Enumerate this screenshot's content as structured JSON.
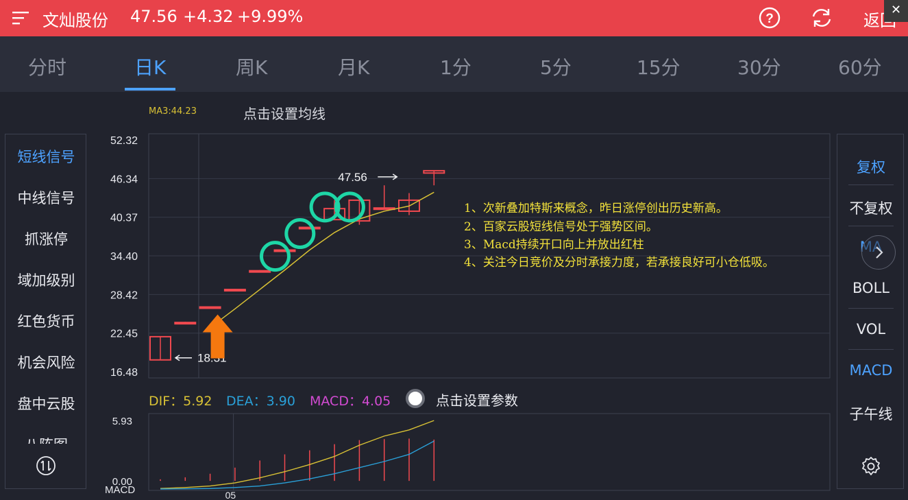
{
  "header": {
    "stock_name": "文灿股份",
    "price": "47.56",
    "change": "+4.32",
    "change_pct": "+9.99%",
    "back_label": "返回",
    "close_label": "✕"
  },
  "tabs": [
    {
      "label": "分时"
    },
    {
      "label": "日K"
    },
    {
      "label": "周K"
    },
    {
      "label": "月K"
    },
    {
      "label": "1分"
    },
    {
      "label": "5分"
    },
    {
      "label": "15分"
    },
    {
      "label": "30分"
    },
    {
      "label": "60分"
    }
  ],
  "active_tab": "日K",
  "ma_label": "MA3:44.23",
  "ma_setting": "点击设置均线",
  "left_menu": [
    {
      "label": "短线信号"
    },
    {
      "label": "中线信号"
    },
    {
      "label": "抓涨停"
    },
    {
      "label": "域加级别"
    },
    {
      "label": "红色货币"
    },
    {
      "label": "机会风险"
    },
    {
      "label": "盘中云股"
    },
    {
      "label": "八阵图"
    }
  ],
  "right_menu": [
    {
      "label": "复权"
    },
    {
      "label": "不复权"
    },
    {
      "label": "MA"
    },
    {
      "label": "BOLL"
    },
    {
      "label": "VOL"
    },
    {
      "label": "MACD"
    },
    {
      "label": "子午线"
    }
  ],
  "indicator": {
    "dif": "DIF：5.92",
    "dea": "DEA：3.90",
    "macd": "MACD：4.05",
    "setting": "点击设置参数"
  },
  "annotations": [
    "1、次新叠加特斯来概念，昨日涨停创出历史新高。",
    "2、百家云股短线信号处于强势区间。",
    "3、Macd持续开口向上并放出红柱",
    "4、关注今日竞价及分时承接力度，若承接良好可小仓低吸。"
  ],
  "colors": {
    "up": "#f0494f",
    "ma": "#d8c135",
    "dif": "#d8c135",
    "dea": "#2aa0d8",
    "macd": "#d24bd2",
    "highlight_circle": "#1ed6a6",
    "arrow": "#f5780f",
    "accent": "#4da2ff"
  },
  "chart_data": [
    {
      "type": "candlestick",
      "y_ticks": [
        "52.32",
        "46.34",
        "40.37",
        "34.40",
        "28.42",
        "22.45",
        "16.48"
      ],
      "ylim": [
        16.48,
        52.32
      ],
      "candles": [
        {
          "open": 18.31,
          "close": 21.9,
          "high": 21.9,
          "low": 18.31
        },
        {
          "open": 24.1,
          "close": 24.1,
          "high": 24.2,
          "low": 24.0
        },
        {
          "open": 26.5,
          "close": 26.5,
          "high": 26.6,
          "low": 26.4
        },
        {
          "open": 29.2,
          "close": 29.2,
          "high": 29.3,
          "low": 29.1
        },
        {
          "open": 32.1,
          "close": 32.1,
          "high": 32.2,
          "low": 32.0
        },
        {
          "open": 35.3,
          "close": 35.3,
          "high": 35.4,
          "low": 35.1
        },
        {
          "open": 38.8,
          "close": 38.8,
          "high": 38.9,
          "low": 38.7
        },
        {
          "open": 40.0,
          "close": 41.7,
          "high": 43.0,
          "low": 40.0
        },
        {
          "open": 39.8,
          "close": 43.0,
          "high": 43.0,
          "low": 39.2
        },
        {
          "open": 41.8,
          "close": 41.8,
          "high": 45.3,
          "low": 41.5
        },
        {
          "open": 41.3,
          "close": 43.0,
          "high": 44.1,
          "low": 40.7
        },
        {
          "open": 47.2,
          "close": 47.56,
          "high": 47.56,
          "low": 45.3
        }
      ],
      "ma_series": {
        "name": "MA3",
        "values": [
          null,
          null,
          23.3,
          26.2,
          29.2,
          32.2,
          35.3,
          38.0,
          40.1,
          41.3,
          42.1,
          44.23
        ]
      },
      "labels": {
        "high_label": "47.56",
        "low_label": "18.31"
      },
      "highlighted_candles": [
        5,
        6,
        7,
        8
      ],
      "arrow_candle": 2
    },
    {
      "type": "macd",
      "y_ticks": [
        "5.93",
        "0.00"
      ],
      "ylim": [
        -0.8,
        5.93
      ],
      "bottom_label": "MACD",
      "x_ticks": [
        {
          "index": 2,
          "label": "05"
        }
      ],
      "macd_bars": [
        0.15,
        0.35,
        0.7,
        1.3,
        2.0,
        2.6,
        3.0,
        3.6,
        4.0,
        4.1,
        4.15,
        4.05
      ],
      "dif": [
        -0.75,
        -0.65,
        -0.5,
        -0.2,
        0.3,
        0.9,
        1.6,
        2.4,
        3.5,
        4.4,
        5.0,
        5.92
      ],
      "dea": [
        -0.8,
        -0.78,
        -0.75,
        -0.65,
        -0.5,
        -0.2,
        0.2,
        0.7,
        1.3,
        1.9,
        2.6,
        3.9
      ]
    }
  ]
}
